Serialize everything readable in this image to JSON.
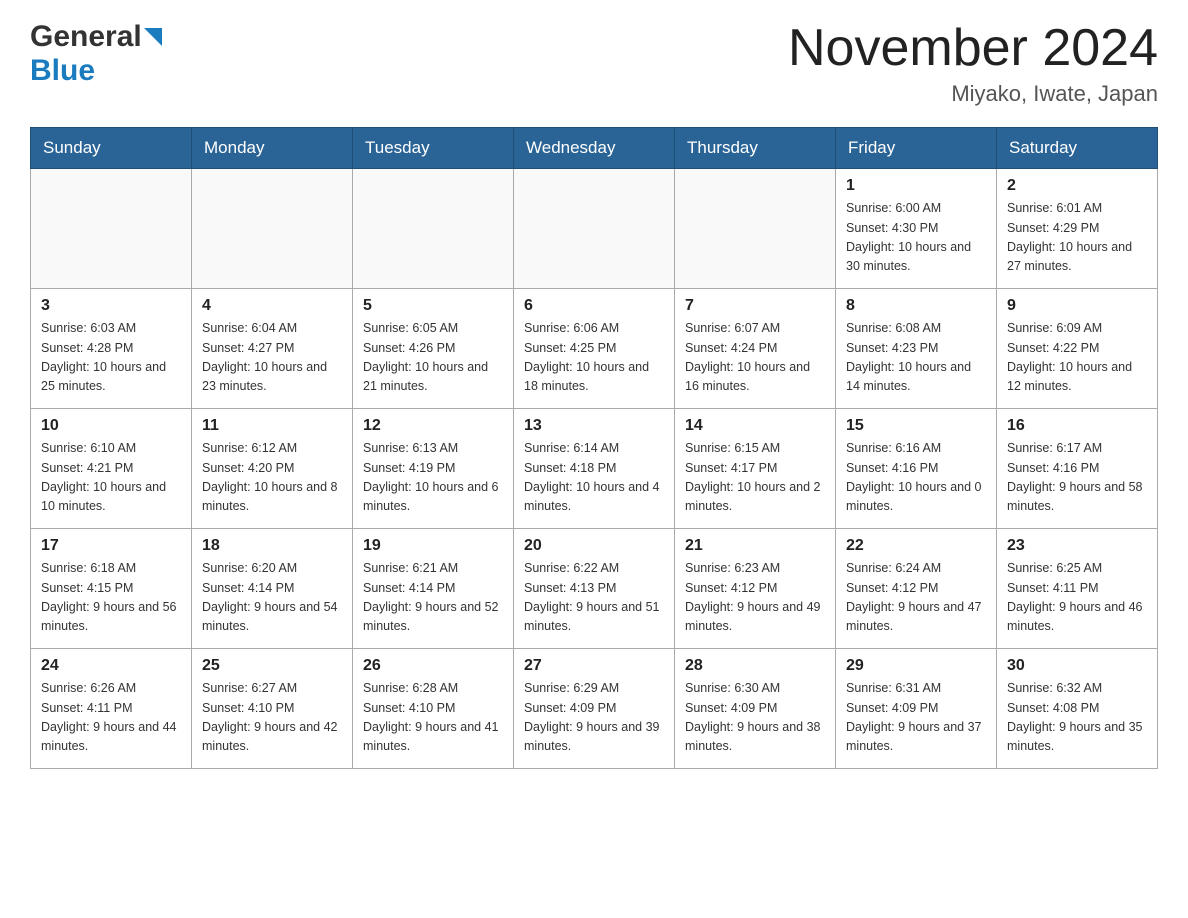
{
  "header": {
    "logo_main": "General",
    "logo_sub": "Blue",
    "month_title": "November 2024",
    "location": "Miyako, Iwate, Japan"
  },
  "days_of_week": [
    "Sunday",
    "Monday",
    "Tuesday",
    "Wednesday",
    "Thursday",
    "Friday",
    "Saturday"
  ],
  "weeks": [
    [
      {
        "day": "",
        "info": ""
      },
      {
        "day": "",
        "info": ""
      },
      {
        "day": "",
        "info": ""
      },
      {
        "day": "",
        "info": ""
      },
      {
        "day": "",
        "info": ""
      },
      {
        "day": "1",
        "info": "Sunrise: 6:00 AM\nSunset: 4:30 PM\nDaylight: 10 hours and 30 minutes."
      },
      {
        "day": "2",
        "info": "Sunrise: 6:01 AM\nSunset: 4:29 PM\nDaylight: 10 hours and 27 minutes."
      }
    ],
    [
      {
        "day": "3",
        "info": "Sunrise: 6:03 AM\nSunset: 4:28 PM\nDaylight: 10 hours and 25 minutes."
      },
      {
        "day": "4",
        "info": "Sunrise: 6:04 AM\nSunset: 4:27 PM\nDaylight: 10 hours and 23 minutes."
      },
      {
        "day": "5",
        "info": "Sunrise: 6:05 AM\nSunset: 4:26 PM\nDaylight: 10 hours and 21 minutes."
      },
      {
        "day": "6",
        "info": "Sunrise: 6:06 AM\nSunset: 4:25 PM\nDaylight: 10 hours and 18 minutes."
      },
      {
        "day": "7",
        "info": "Sunrise: 6:07 AM\nSunset: 4:24 PM\nDaylight: 10 hours and 16 minutes."
      },
      {
        "day": "8",
        "info": "Sunrise: 6:08 AM\nSunset: 4:23 PM\nDaylight: 10 hours and 14 minutes."
      },
      {
        "day": "9",
        "info": "Sunrise: 6:09 AM\nSunset: 4:22 PM\nDaylight: 10 hours and 12 minutes."
      }
    ],
    [
      {
        "day": "10",
        "info": "Sunrise: 6:10 AM\nSunset: 4:21 PM\nDaylight: 10 hours and 10 minutes."
      },
      {
        "day": "11",
        "info": "Sunrise: 6:12 AM\nSunset: 4:20 PM\nDaylight: 10 hours and 8 minutes."
      },
      {
        "day": "12",
        "info": "Sunrise: 6:13 AM\nSunset: 4:19 PM\nDaylight: 10 hours and 6 minutes."
      },
      {
        "day": "13",
        "info": "Sunrise: 6:14 AM\nSunset: 4:18 PM\nDaylight: 10 hours and 4 minutes."
      },
      {
        "day": "14",
        "info": "Sunrise: 6:15 AM\nSunset: 4:17 PM\nDaylight: 10 hours and 2 minutes."
      },
      {
        "day": "15",
        "info": "Sunrise: 6:16 AM\nSunset: 4:16 PM\nDaylight: 10 hours and 0 minutes."
      },
      {
        "day": "16",
        "info": "Sunrise: 6:17 AM\nSunset: 4:16 PM\nDaylight: 9 hours and 58 minutes."
      }
    ],
    [
      {
        "day": "17",
        "info": "Sunrise: 6:18 AM\nSunset: 4:15 PM\nDaylight: 9 hours and 56 minutes."
      },
      {
        "day": "18",
        "info": "Sunrise: 6:20 AM\nSunset: 4:14 PM\nDaylight: 9 hours and 54 minutes."
      },
      {
        "day": "19",
        "info": "Sunrise: 6:21 AM\nSunset: 4:14 PM\nDaylight: 9 hours and 52 minutes."
      },
      {
        "day": "20",
        "info": "Sunrise: 6:22 AM\nSunset: 4:13 PM\nDaylight: 9 hours and 51 minutes."
      },
      {
        "day": "21",
        "info": "Sunrise: 6:23 AM\nSunset: 4:12 PM\nDaylight: 9 hours and 49 minutes."
      },
      {
        "day": "22",
        "info": "Sunrise: 6:24 AM\nSunset: 4:12 PM\nDaylight: 9 hours and 47 minutes."
      },
      {
        "day": "23",
        "info": "Sunrise: 6:25 AM\nSunset: 4:11 PM\nDaylight: 9 hours and 46 minutes."
      }
    ],
    [
      {
        "day": "24",
        "info": "Sunrise: 6:26 AM\nSunset: 4:11 PM\nDaylight: 9 hours and 44 minutes."
      },
      {
        "day": "25",
        "info": "Sunrise: 6:27 AM\nSunset: 4:10 PM\nDaylight: 9 hours and 42 minutes."
      },
      {
        "day": "26",
        "info": "Sunrise: 6:28 AM\nSunset: 4:10 PM\nDaylight: 9 hours and 41 minutes."
      },
      {
        "day": "27",
        "info": "Sunrise: 6:29 AM\nSunset: 4:09 PM\nDaylight: 9 hours and 39 minutes."
      },
      {
        "day": "28",
        "info": "Sunrise: 6:30 AM\nSunset: 4:09 PM\nDaylight: 9 hours and 38 minutes."
      },
      {
        "day": "29",
        "info": "Sunrise: 6:31 AM\nSunset: 4:09 PM\nDaylight: 9 hours and 37 minutes."
      },
      {
        "day": "30",
        "info": "Sunrise: 6:32 AM\nSunset: 4:08 PM\nDaylight: 9 hours and 35 minutes."
      }
    ]
  ]
}
